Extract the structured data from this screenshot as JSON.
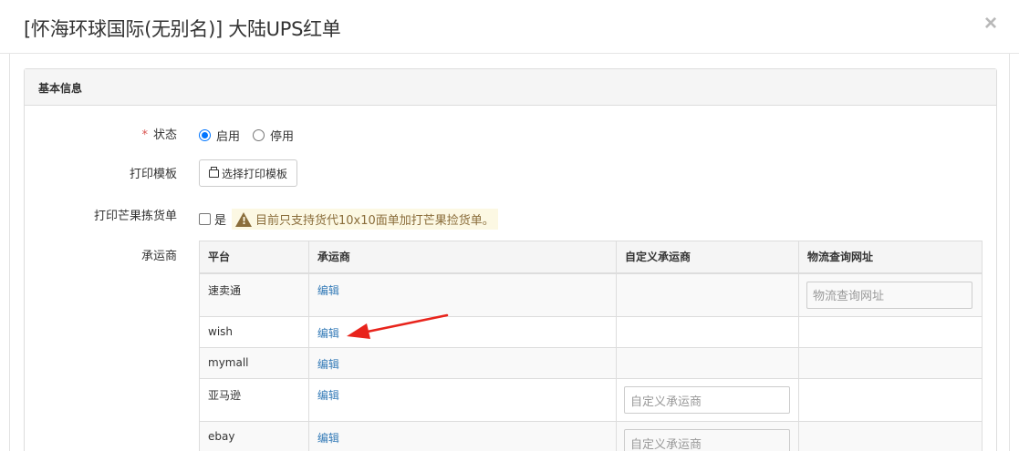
{
  "modal": {
    "title": "[怀海环球国际(无别名)] 大陆UPS红单",
    "close": "×"
  },
  "panel": {
    "heading": "基本信息"
  },
  "status": {
    "required_mark": "*",
    "label": "状态",
    "options": [
      "启用",
      "停用"
    ],
    "selected": "启用"
  },
  "print_template": {
    "label": "打印模板",
    "button": "选择打印模板",
    "icon": "printer-icon"
  },
  "mango": {
    "label": "打印芒果拣货单",
    "checkbox_label": "是",
    "checked": false,
    "warning": "目前只支持货代10x10面单加打芒果捡货单。",
    "warning_icon": "warning-icon"
  },
  "carrier": {
    "label": "承运商",
    "columns": [
      "平台",
      "承运商",
      "自定义承运商",
      "物流查询网址"
    ],
    "rows": [
      {
        "platform": "速卖通",
        "edit": "编辑",
        "custom_placeholder": "",
        "url_placeholder": "物流查询网址"
      },
      {
        "platform": "wish",
        "edit": "编辑",
        "custom_placeholder": "",
        "url_placeholder": ""
      },
      {
        "platform": "mymall",
        "edit": "编辑",
        "custom_placeholder": "",
        "url_placeholder": ""
      },
      {
        "platform": "亚马逊",
        "edit": "编辑",
        "custom_placeholder": "自定义承运商",
        "url_placeholder": ""
      },
      {
        "platform": "ebay",
        "edit": "编辑",
        "custom_placeholder": "自定义承运商",
        "url_placeholder": ""
      }
    ]
  },
  "colors": {
    "accent": "#337ab7",
    "required": "#d9534f",
    "warning_bg": "#fcf8e3",
    "warning_text": "#8a6d3b",
    "annotation_arrow": "#e8241c"
  }
}
